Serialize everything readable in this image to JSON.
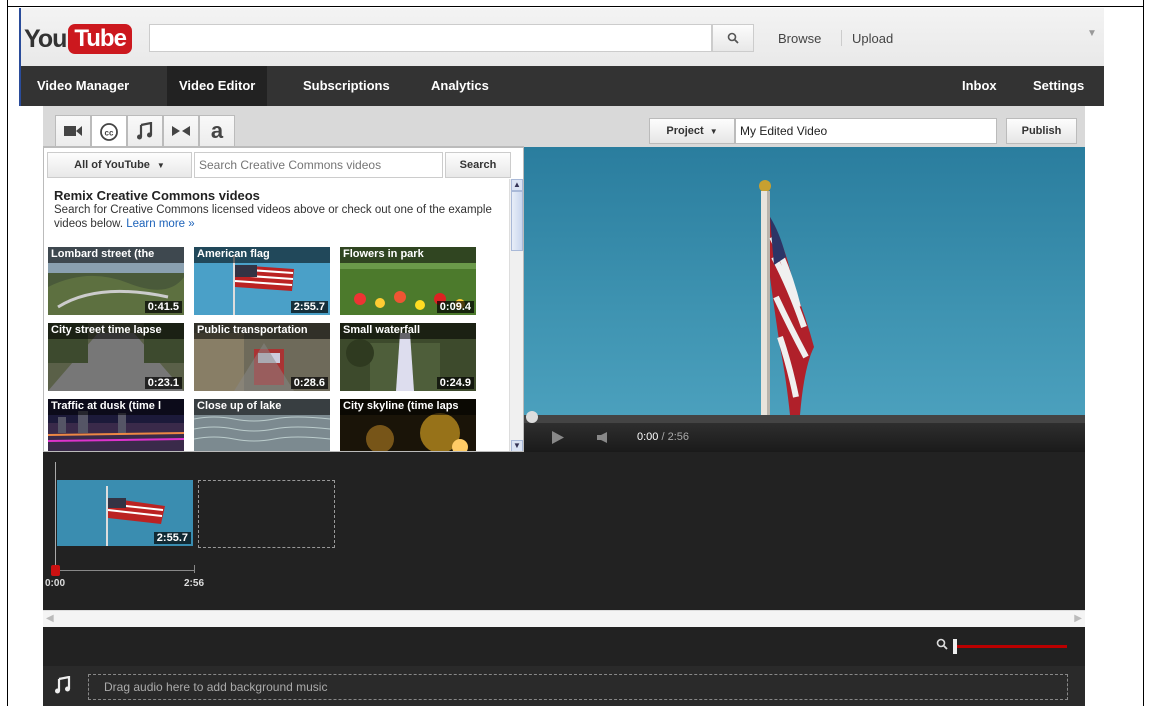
{
  "header": {
    "logo_you": "You",
    "logo_tube": "Tube",
    "search_value": "",
    "browse": "Browse",
    "upload": "Upload"
  },
  "nav": {
    "items": [
      "Video Manager",
      "Video Editor",
      "Subscriptions",
      "Analytics"
    ],
    "active": "Video Editor",
    "right_items": [
      "Inbox",
      "Settings"
    ]
  },
  "editor": {
    "tab_icons": [
      "video-camera-icon",
      "creative-commons-icon",
      "music-note-icon",
      "transitions-icon",
      "text-icon"
    ],
    "text_tab_glyph": "a",
    "project_label": "Project",
    "project_name": "My Edited Video",
    "publish_label": "Publish"
  },
  "library": {
    "scope_label": "All of YouTube",
    "search_placeholder": "Search Creative Commons videos",
    "search_button": "Search",
    "title": "Remix Creative Commons videos",
    "description": "Search for Creative Commons licensed videos above or check out one of the example videos below.",
    "learn_more": "Learn more »",
    "videos": [
      {
        "title": "Lombard street (the",
        "duration": "0:41.5"
      },
      {
        "title": "American flag",
        "duration": "2:55.7"
      },
      {
        "title": "Flowers in park",
        "duration": "0:09.4"
      },
      {
        "title": "City street time lapse",
        "duration": "0:23.1"
      },
      {
        "title": "Public transportation",
        "duration": "0:28.6"
      },
      {
        "title": "Small waterfall",
        "duration": "0:24.9"
      },
      {
        "title": "Traffic at dusk (time l",
        "duration": ""
      },
      {
        "title": "Close up of lake",
        "duration": ""
      },
      {
        "title": "City skyline (time laps",
        "duration": ""
      }
    ]
  },
  "player": {
    "current_time": "0:00",
    "total_time": "/ 2:56"
  },
  "timeline": {
    "clip_duration": "2:55.7",
    "start_label": "0:00",
    "end_label": "2:56"
  },
  "audio": {
    "drop_text": "Drag audio here to add background music"
  },
  "colors": {
    "brand_red": "#cc181e",
    "nav_bg": "#333333",
    "timeline_bg": "#222222",
    "link_blue": "#1c62b9"
  }
}
